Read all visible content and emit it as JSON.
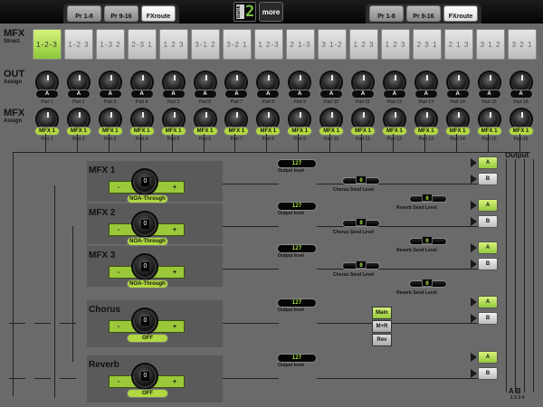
{
  "header": {
    "tabs_left": [
      "Pr 1-8",
      "Pr 9-16",
      "FXroute"
    ],
    "tabs_right": [
      "Pr 1-8",
      "Pr 9-16",
      "FXroute"
    ],
    "selected_tab": "FXroute",
    "bank_label": "bank",
    "bank_value": "2",
    "more_label": "more"
  },
  "mfx_struct": {
    "title": "MFX",
    "sub": "Struct.",
    "items": [
      "1-2-3",
      "1-2 3",
      "1-3 2",
      "2-3 1",
      "1 2 3",
      "3-1 2",
      "3-2 1",
      "1 2-3",
      "2 1-3",
      "3 1-2",
      "1 2 3",
      "1 2 3",
      "2 3 1",
      "2 1 3",
      "3 1 2",
      "3 2 1"
    ],
    "selected_index": 0
  },
  "out_assign": {
    "title": "OUT",
    "sub": "Assign",
    "values": [
      "A",
      "A",
      "A",
      "A",
      "A",
      "A",
      "A",
      "A",
      "A",
      "A",
      "A",
      "A",
      "A",
      "A",
      "A",
      "A"
    ]
  },
  "mfx_assign": {
    "title": "MFX",
    "sub": "Assign",
    "values": [
      "MFX 1",
      "MFX 1",
      "MFX 1",
      "MFX 1",
      "MFX 1",
      "MFX 1",
      "MFX 1",
      "MFX 1",
      "MFX 1",
      "MFX 1",
      "MFX 1",
      "MFX 1",
      "MFX 1",
      "MFX 1",
      "MFX 1",
      "MFX 1"
    ]
  },
  "parts": [
    "Part 1",
    "Part 2",
    "Part 3",
    "Part 4",
    "Part 5",
    "Part 6",
    "Part 7",
    "Part 8",
    "Part 9",
    "Part 10",
    "Part 11",
    "Part 12",
    "Part 13",
    "Part 14",
    "Part 15",
    "Part 16"
  ],
  "routing": {
    "output_label": "Output",
    "output_level_label": "Output level",
    "chorus_send_label": "Chorus Send Level",
    "reverb_send_label": "Reverb Send Level",
    "minus": "-",
    "plus": "+",
    "btn_a": "A",
    "btn_b": "B",
    "ab_footer": "A   B",
    "ab_footer_nums": "1 2 3 4",
    "effects": [
      {
        "name": "MFX 1",
        "knob": "0",
        "type": "NOA-Through",
        "level": "127",
        "chorus": "0",
        "reverb": "0",
        "out": "A"
      },
      {
        "name": "MFX 2",
        "knob": "0",
        "type": "NOA-Through",
        "level": "127",
        "chorus": "0",
        "reverb": "0",
        "out": "A"
      },
      {
        "name": "MFX 3",
        "knob": "0",
        "type": "NOA-Through",
        "level": "127",
        "chorus": "0",
        "reverb": "0",
        "out": "A"
      },
      {
        "name": "Chorus",
        "knob": "0",
        "type": "OFF",
        "level": "127",
        "out": "A"
      },
      {
        "name": "Reverb",
        "knob": "0",
        "type": "OFF",
        "level": "127",
        "out": "A"
      }
    ],
    "chorus_out_buttons": [
      "Main",
      "M+R",
      "Rev"
    ],
    "chorus_out_selected": "Main"
  }
}
